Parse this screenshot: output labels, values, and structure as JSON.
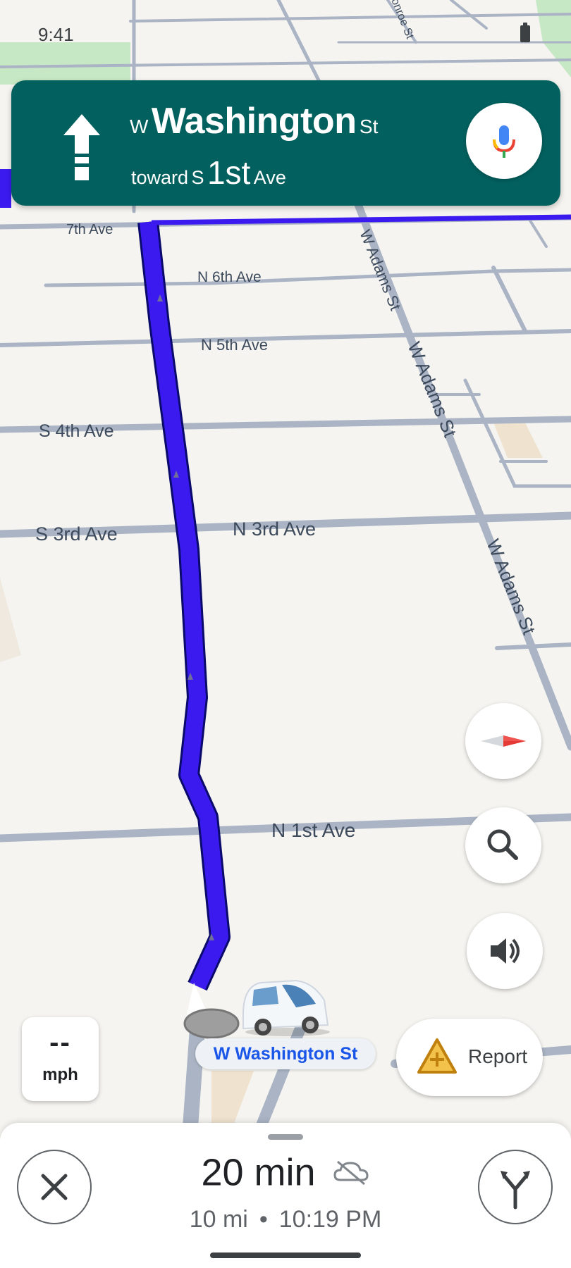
{
  "status_bar": {
    "time": "9:41"
  },
  "map": {
    "street_labels": {
      "seventh_ave": "7th Ave",
      "n_6th_ave": "N 6th Ave",
      "n_5th_ave": "N 5th Ave",
      "s_4th_ave": "S 4th Ave",
      "s_3rd_ave": "S 3rd Ave",
      "n_3rd_ave": "N 3rd Ave",
      "n_1st_ave": "N 1st Ave",
      "w_adams_st": "W Adams St",
      "monroe_st": "onroe St"
    },
    "route_color": "#3b1af0",
    "current_road": "W Washington St"
  },
  "nav_banner": {
    "icon": "straight-arrow-icon",
    "street_prefix": "W",
    "street_name": "Washington",
    "street_suffix": "St",
    "toward_label": "toward",
    "toward_prefix": "S",
    "toward_name": "1st",
    "toward_suffix": "Ave",
    "background_color": "#02605e"
  },
  "speed": {
    "value": "--",
    "unit": "mph"
  },
  "controls": {
    "report_label": "Report",
    "icons": [
      "compass-icon",
      "search-icon",
      "volume-icon",
      "microphone-icon"
    ]
  },
  "trip": {
    "duration": "20 min",
    "distance": "10 mi",
    "separator": "•",
    "arrival": "10:19 PM"
  }
}
